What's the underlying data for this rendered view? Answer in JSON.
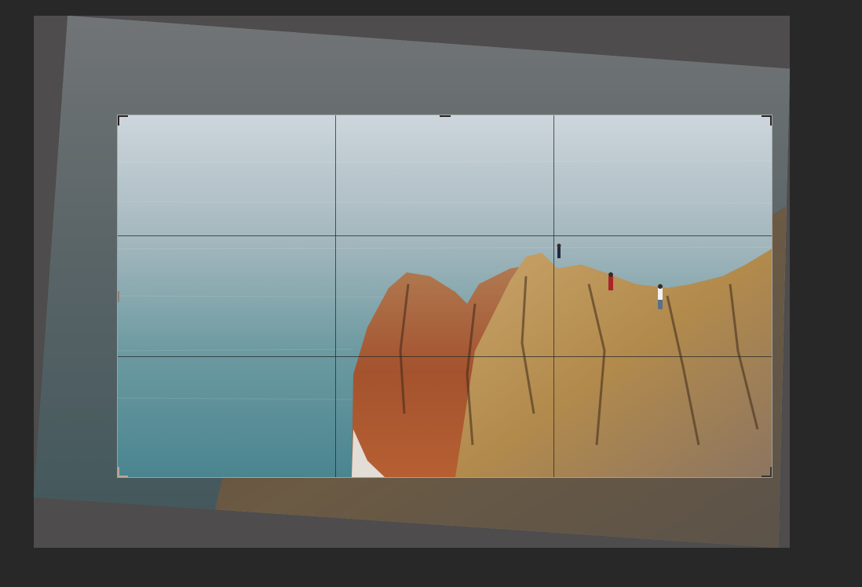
{
  "app": {
    "mode": "crop-rotate"
  },
  "image": {
    "description_icon": "landscape-photo",
    "scene": [
      "sea",
      "rocky-cliff",
      "people"
    ]
  },
  "crop": {
    "grid": "rule-of-thirds"
  },
  "colors": {
    "background": "#282828",
    "canvas": "#4e4c4c",
    "sea_top": "#c9d3d8",
    "sea_bottom": "#4f8a92",
    "rock_orange": "#a5562e",
    "rock_gold": "#b58a4a"
  }
}
